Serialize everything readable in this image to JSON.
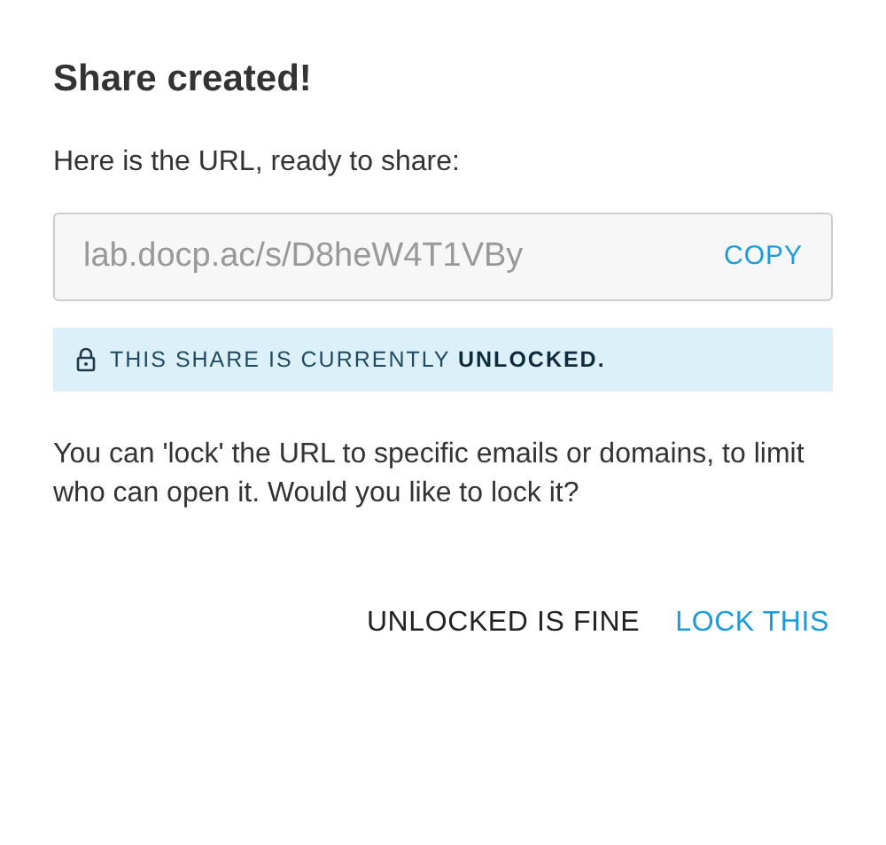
{
  "dialog": {
    "title": "Share created!",
    "intro": "Here is the URL, ready to share:",
    "url_field": {
      "value": "lab.docp.ac/s/D8heW4T1VBy",
      "action": "COPY"
    },
    "notice": "THIS SHARE IS CURRENTLY **UNLOCKED.**",
    "message": "You can 'lock' the URL to specific emails or domains, to limit who can open it. Would you like to lock it?",
    "buttons": [
      {
        "label": "UNLOCKED IS FINE",
        "kind": "secondary"
      },
      {
        "label": "LOCK THIS",
        "kind": "primary"
      }
    ]
  }
}
